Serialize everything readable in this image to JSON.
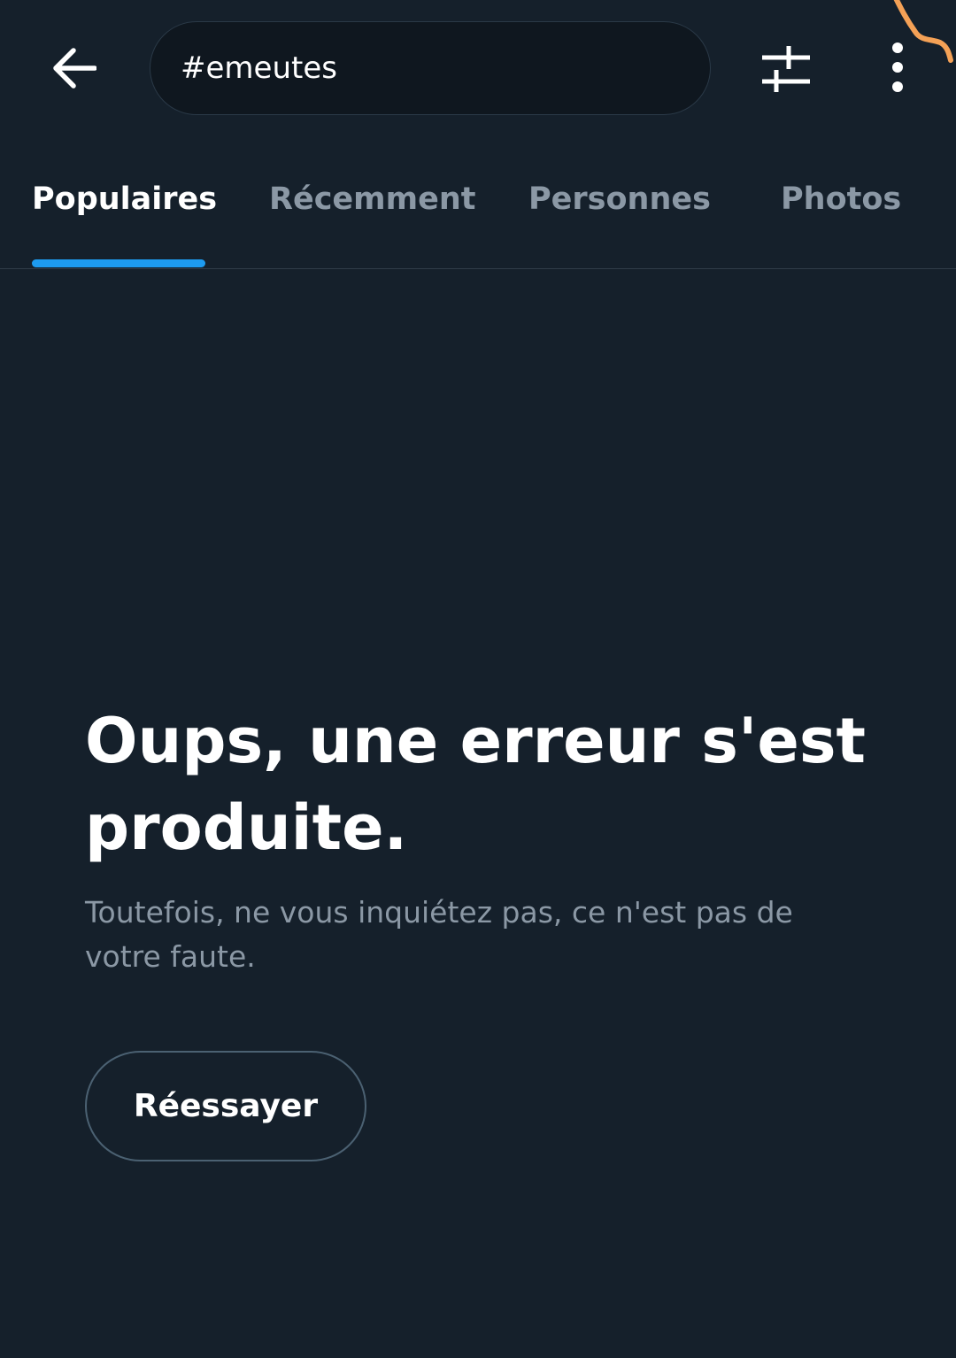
{
  "search": {
    "query": "#emeutes"
  },
  "header": {
    "back_icon": "arrow-left-icon",
    "filter_icon": "sliders-icon",
    "more_icon": "more-vertical-icon"
  },
  "tabs": [
    {
      "label": "Populaires",
      "active": true
    },
    {
      "label": "Récemment",
      "active": false
    },
    {
      "label": "Personnes",
      "active": false
    },
    {
      "label": "Photos",
      "active": false
    }
  ],
  "error": {
    "title": "Oups, une erreur s'est produite.",
    "message": "Toutefois, ne vous inquiétez pas, ce n'est pas de votre faute.",
    "retry_label": "Réessayer"
  },
  "colors": {
    "background": "#15202b",
    "accent": "#1d9bf0",
    "secondary_text": "#8b98a5",
    "annotation": "#f4a156"
  }
}
